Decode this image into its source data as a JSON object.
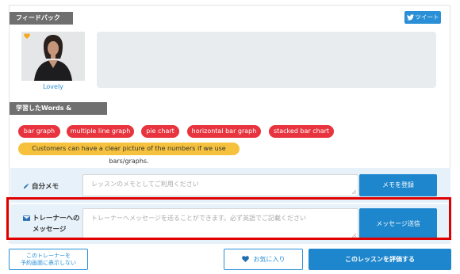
{
  "feedback": {
    "section_label": "フィードバック",
    "tweet_label": "ツイート"
  },
  "tutor": {
    "name": "Lovely"
  },
  "phrases": {
    "section_label": "学習したWords & Phrases",
    "tags": [
      "bar graph",
      "multiple line graph",
      "pie chart",
      "horizontal bar graph",
      "stacked bar chart"
    ],
    "sentence": "Customers can have a clear picture of the numbers if we use bars/graphs."
  },
  "memo": {
    "label": "自分メモ",
    "placeholder": "レッスンのメモとしてご利用ください",
    "button": "メモを登録"
  },
  "message": {
    "label_line1": "トレーナーへの",
    "label_line2": "メッセージ",
    "placeholder": "トレーナーへメッセージを送ることができます。必ず英語でご記載ください",
    "button": "メッセージ送信"
  },
  "footer": {
    "hide_line1": "このトレーナーを",
    "hide_line2": "予約画面に表示しない",
    "favorite": "お気に入り",
    "rate": "このレッスンを評価する"
  },
  "colors": {
    "accent": "#1e86cc",
    "tag_red": "#e8343e",
    "tag_yellow": "#f6c23d",
    "highlight_red": "#e00000"
  }
}
